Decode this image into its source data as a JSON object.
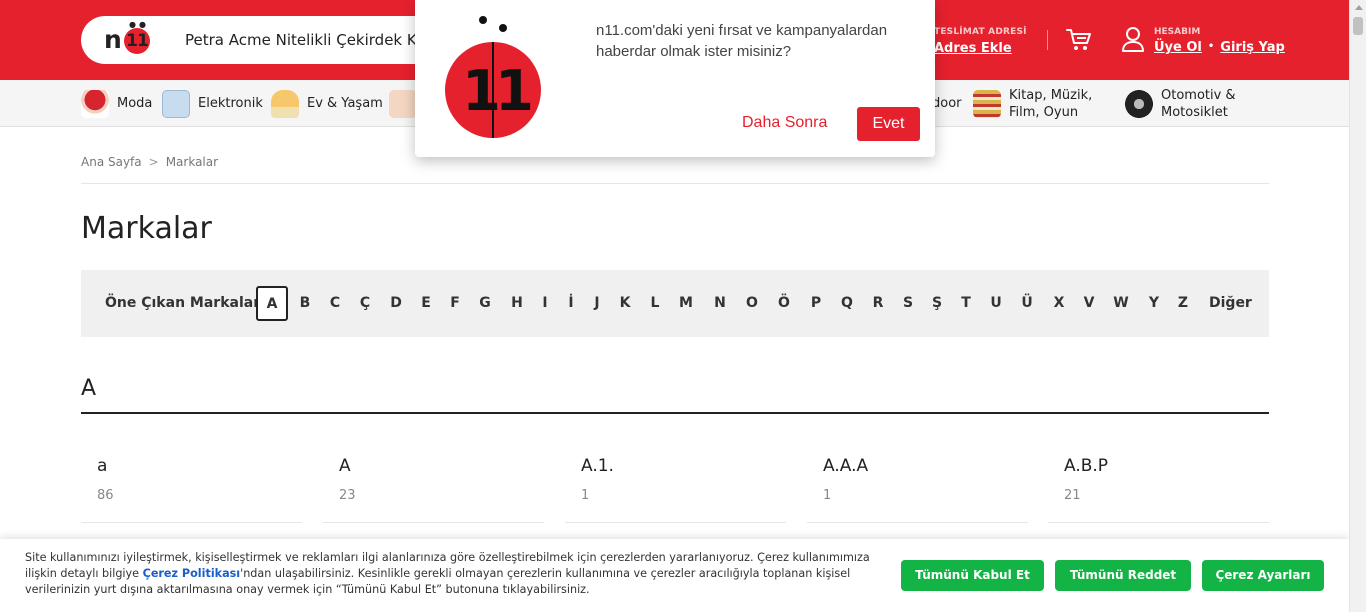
{
  "header": {
    "logo_text": "n11",
    "search_value": "Petra Acme Nitelikli Çekirdek Kahve",
    "delivery_label": "TESLİMAT ADRESİ",
    "delivery_link": "Adres Ekle",
    "account_label": "HESABIM",
    "signup_label": "Üye Ol",
    "login_label": "Giriş Yap",
    "brand_color": "#e6212e"
  },
  "categories": [
    {
      "label": "Moda",
      "icon": "fashion-icon"
    },
    {
      "label": "Elektronik",
      "icon": "electronics-icon"
    },
    {
      "label": "Ev & Yaşam",
      "icon": "home-living-icon"
    },
    {
      "label": "",
      "icon": "baby-icon"
    },
    {
      "label": "door",
      "icon": "outdoor-icon"
    },
    {
      "label": "Kitap, Müzik, Film, Oyun",
      "icon": "books-icon"
    },
    {
      "label": "Otomotiv & Motosiklet",
      "icon": "tire-icon"
    }
  ],
  "breadcrumb": {
    "home": "Ana Sayfa",
    "current": "Markalar"
  },
  "page_title": "Markalar",
  "alphabet": {
    "featured": "Öne Çıkan Markalar",
    "selected": "A",
    "letters": [
      "A",
      "B",
      "C",
      "Ç",
      "D",
      "E",
      "F",
      "G",
      "H",
      "I",
      "İ",
      "J",
      "K",
      "L",
      "M",
      "N",
      "O",
      "Ö",
      "P",
      "Q",
      "R",
      "S",
      "Ş",
      "T",
      "U",
      "Ü",
      "X",
      "V",
      "W",
      "Y",
      "Z"
    ],
    "other": "Diğer"
  },
  "section": {
    "letter": "A",
    "brands": [
      {
        "name": "a",
        "count": "86"
      },
      {
        "name": "A",
        "count": "23"
      },
      {
        "name": "A.1.",
        "count": "1"
      },
      {
        "name": "A.A.A",
        "count": "1"
      },
      {
        "name": "A.B.P",
        "count": "21"
      }
    ]
  },
  "popup": {
    "message": "n11.com'daki yeni fırsat ve kampanyalardan haberdar olmak ister misiniz?",
    "later": "Daha Sonra",
    "yes": "Evet"
  },
  "cookie": {
    "text_before": "Site kullanımınızı iyileştirmek, kişiselleştirmek ve reklamları ilgi alanlarınıza göre özelleştirebilmek için çerezlerden yararlanıyoruz. Çerez kullanımımıza ilişkin detaylı bilgiye ",
    "policy_link": "Çerez Politikası",
    "text_after": "'ndan ulaşabilirsiniz. Kesinlikle gerekli olmayan çerezlerin kullanımına ve çerezler aracılığıyla toplanan kişisel verilerinizin yurt dışına aktarılmasına onay vermek için “Tümünü Kabul Et” butonuna tıklayabilirsiniz.",
    "accept_all": "Tümünü Kabul Et",
    "reject_all": "Tümünü Reddet",
    "settings": "Çerez Ayarları",
    "button_color": "#13b346"
  }
}
